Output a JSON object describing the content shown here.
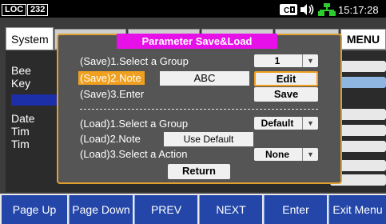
{
  "status": {
    "mode_badge": "LOC",
    "address_badge": "232",
    "time": "15:17:28",
    "icons": [
      "lan-icon",
      "speaker-icon",
      "network-icon"
    ]
  },
  "background": {
    "tab_label": "System",
    "menu_label": "MENU",
    "labels": [
      "Bee",
      "Key",
      "Date",
      "Tim",
      "Tim"
    ]
  },
  "dialog": {
    "title": "Parameter Save&Load",
    "save_group_label": "(Save)1.Select a Group",
    "save_group_value": "1",
    "save_note_label": "(Save)2.Note",
    "save_note_value": "ABC",
    "edit_label": "Edit",
    "save_enter_label": "(Save)3.Enter",
    "save_label": "Save",
    "load_group_label": "(Load)1.Select a Group",
    "load_group_value": "Default",
    "load_note_label": "(Load)2.Note",
    "load_note_value": "Use Default",
    "load_action_label": "(Load)3.Select a Action",
    "load_action_value": "None",
    "return_label": "Return"
  },
  "softkeys": [
    "Page Up",
    "Page Down",
    "PREV",
    "NEXT",
    "Enter",
    "Exit Menu"
  ],
  "colors": {
    "dialog_title_bg": "#e810e8",
    "highlight": "#f0a020",
    "softkey_bg": "#2346a8"
  }
}
